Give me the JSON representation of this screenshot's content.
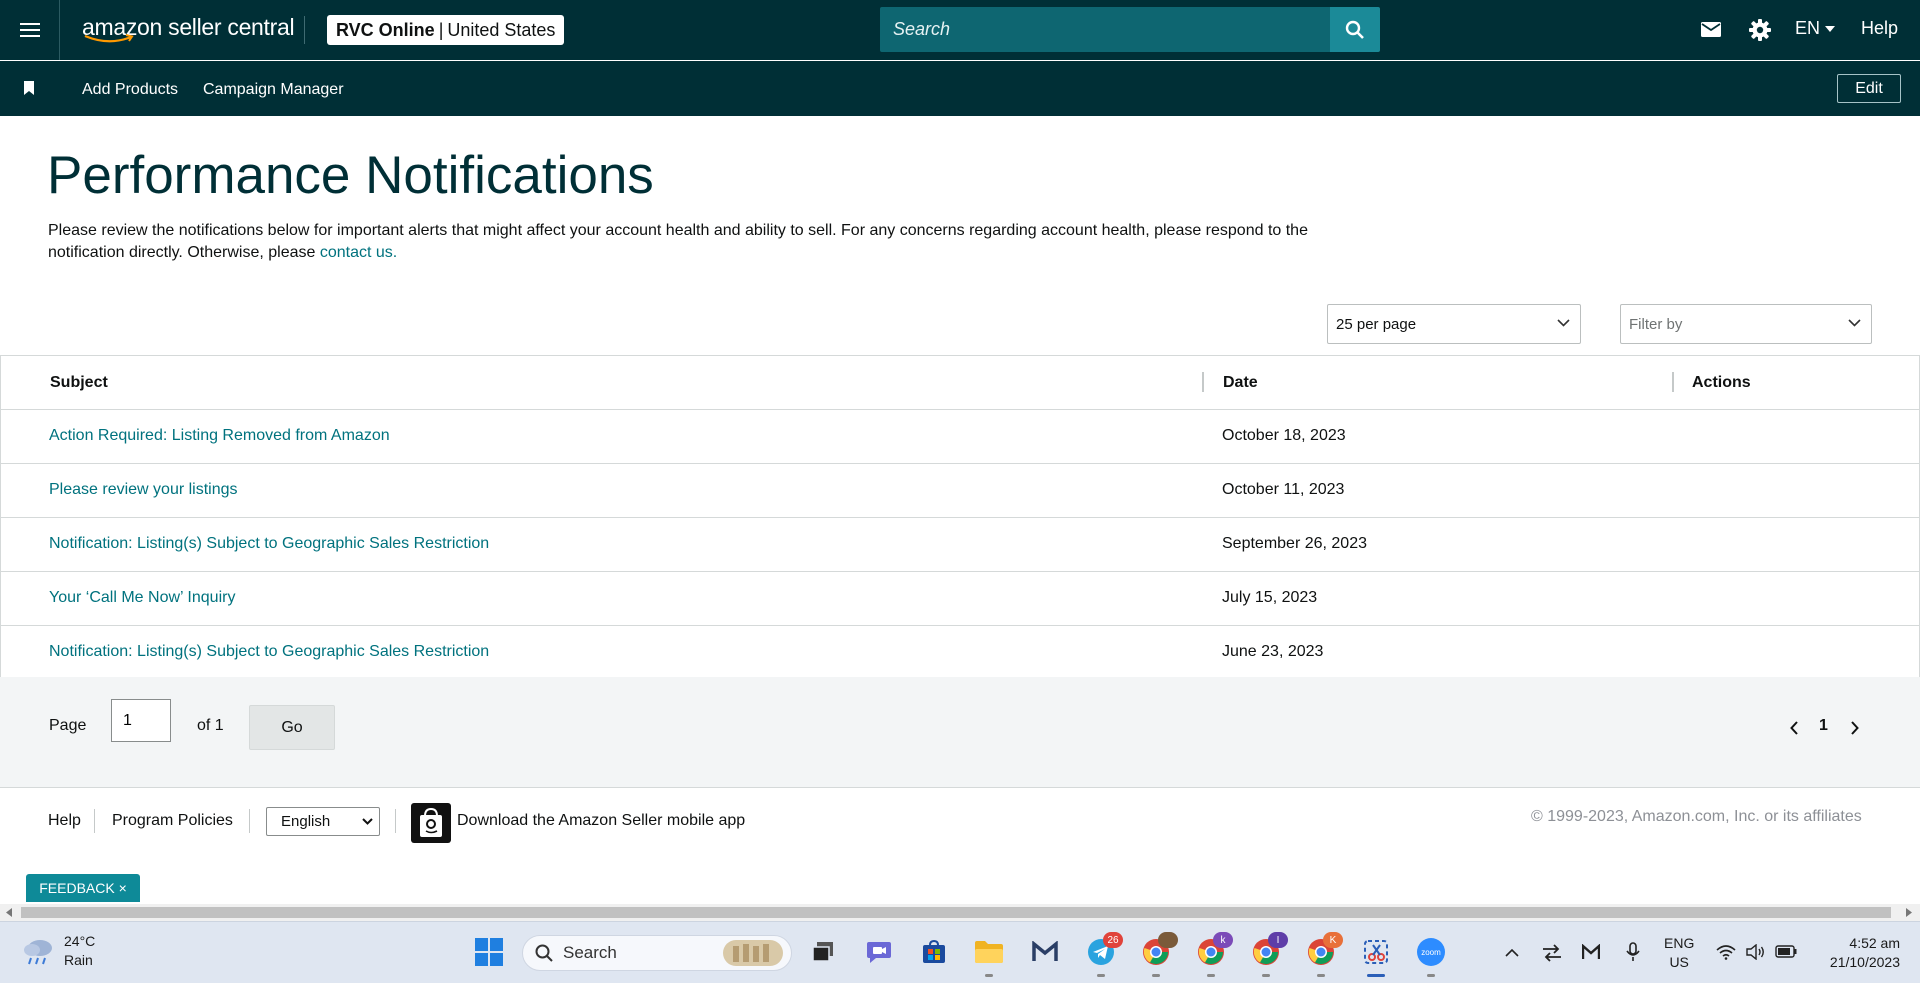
{
  "topnav": {
    "logo_text": "amazon seller central",
    "store_name": "RVC Online",
    "store_region": "United States",
    "search_placeholder": "Search",
    "language": "EN",
    "help": "Help"
  },
  "subnav": {
    "links": [
      "Add Products",
      "Campaign Manager"
    ],
    "edit": "Edit"
  },
  "page": {
    "title": "Performance Notifications",
    "intro_text": "Please review the notifications below for important alerts that might affect your account health and ability to sell. For any concerns regarding account health, please respond to the notification directly. Otherwise, please ",
    "intro_link": "contact us.",
    "per_page": "25 per page",
    "filter_placeholder": "Filter by"
  },
  "table": {
    "columns": [
      "Subject",
      "Date",
      "Actions"
    ],
    "rows": [
      {
        "subject": "Action Required: Listing Removed from Amazon",
        "date": "October 18, 2023"
      },
      {
        "subject": "Please review your listings",
        "date": "October 11, 2023"
      },
      {
        "subject": "Notification: Listing(s) Subject to Geographic Sales Restriction",
        "date": "September 26, 2023"
      },
      {
        "subject": "Your ‘Call Me Now’ Inquiry",
        "date": "July 15, 2023"
      },
      {
        "subject": "Notification: Listing(s) Subject to Geographic Sales Restriction",
        "date": "June 23, 2023"
      }
    ]
  },
  "pagination": {
    "page_label": "Page",
    "page_value": "1",
    "of_label": "of 1",
    "go": "Go",
    "current": "1"
  },
  "footer": {
    "help": "Help",
    "program_policies": "Program Policies",
    "language": "English",
    "app_text": "Download the Amazon Seller mobile app",
    "copyright": "© 1999-2023, Amazon.com, Inc. or its affiliates",
    "feedback": "FEEDBACK ×"
  },
  "taskbar": {
    "weather_temp": "24°C",
    "weather_desc": "Rain",
    "search": "Search",
    "lang_line1": "ENG",
    "lang_line2": "US",
    "time": "4:52 am",
    "date": "21/10/2023",
    "badges": {
      "telegram": "26",
      "chrome_k": "k",
      "chrome_i": "I",
      "chrome_K": "K"
    }
  },
  "colors": {
    "nav_bg": "#002f36",
    "search_bg": "#0e6671",
    "search_btn": "#1b8a98",
    "link": "#00727e",
    "title": "#002f36",
    "feedback_bg": "#0e8a98"
  }
}
